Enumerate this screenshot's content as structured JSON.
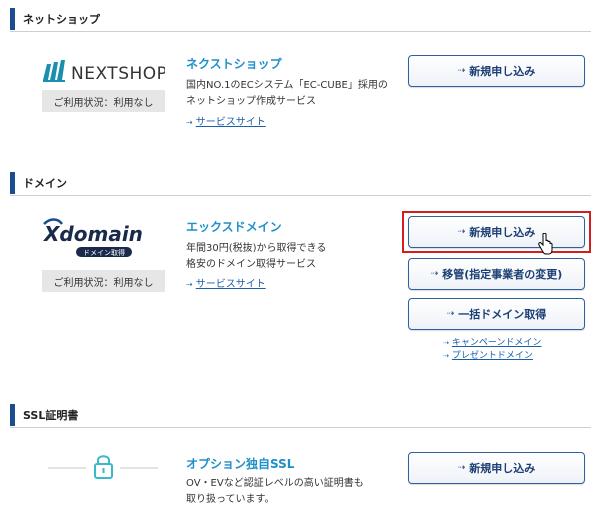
{
  "sections": {
    "netshop": {
      "title": "ネットショップ"
    },
    "domain": {
      "title": "ドメイン"
    },
    "ssl": {
      "title": "SSL証明書"
    }
  },
  "nextshop": {
    "logo_text": "NEXTSHOP",
    "status": "ご利用状況：利用なし",
    "name": "ネクストショップ",
    "desc_line1": "国内NO.1のECシステム「EC-CUBE」採用の",
    "desc_line2": "ネットショップ作成サービス",
    "link": "サービスサイト",
    "button": "新規申し込み"
  },
  "xdomain": {
    "logo_text": "Xdomain",
    "logo_sub": "ドメイン取得",
    "status": "ご利用状況：利用なし",
    "name": "エックスドメイン",
    "desc_line1": "年間30円(税抜)から取得できる",
    "desc_line2": "格安のドメイン取得サービス",
    "link": "サービスサイト",
    "button_new": "新規申し込み",
    "button_transfer": "移管(指定事業者の変更)",
    "button_bulk": "一括ドメイン取得",
    "link_campaign": "キャンペーンドメイン",
    "link_present": "プレゼントドメイン"
  },
  "ssl": {
    "name": "オプション独自SSL",
    "desc_line1": "OV・EVなど認証レベルの高い証明書も",
    "desc_line2": "取り扱っています。",
    "button": "新規申し込み"
  },
  "colors": {
    "accent": "#1a4d8f",
    "service_name": "#1e90c8",
    "highlight": "#d11f1f",
    "lock": "#3bb8c9"
  }
}
